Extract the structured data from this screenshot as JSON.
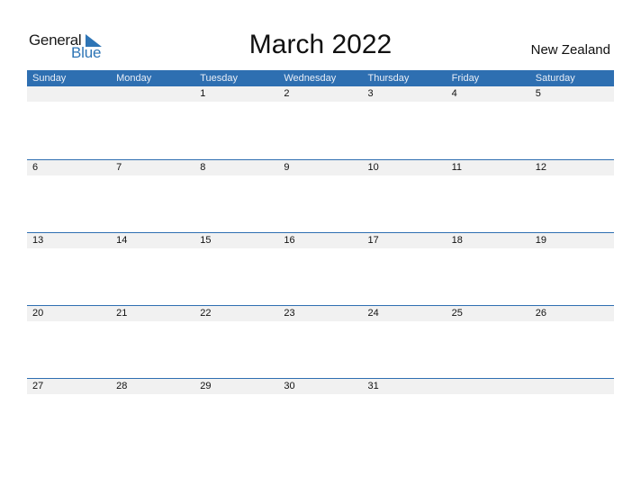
{
  "logo": {
    "word1": "General",
    "word2": "Blue",
    "icon": "triangle-flag-icon"
  },
  "title": "March 2022",
  "country": "New Zealand",
  "colors": {
    "accent": "#2e6fb1",
    "row_bg": "#f1f1f1"
  },
  "weekdays": [
    "Sunday",
    "Monday",
    "Tuesday",
    "Wednesday",
    "Thursday",
    "Friday",
    "Saturday"
  ],
  "weeks": [
    [
      "",
      "",
      "1",
      "2",
      "3",
      "4",
      "5"
    ],
    [
      "6",
      "7",
      "8",
      "9",
      "10",
      "11",
      "12"
    ],
    [
      "13",
      "14",
      "15",
      "16",
      "17",
      "18",
      "19"
    ],
    [
      "20",
      "21",
      "22",
      "23",
      "24",
      "25",
      "26"
    ],
    [
      "27",
      "28",
      "29",
      "30",
      "31",
      "",
      ""
    ]
  ]
}
